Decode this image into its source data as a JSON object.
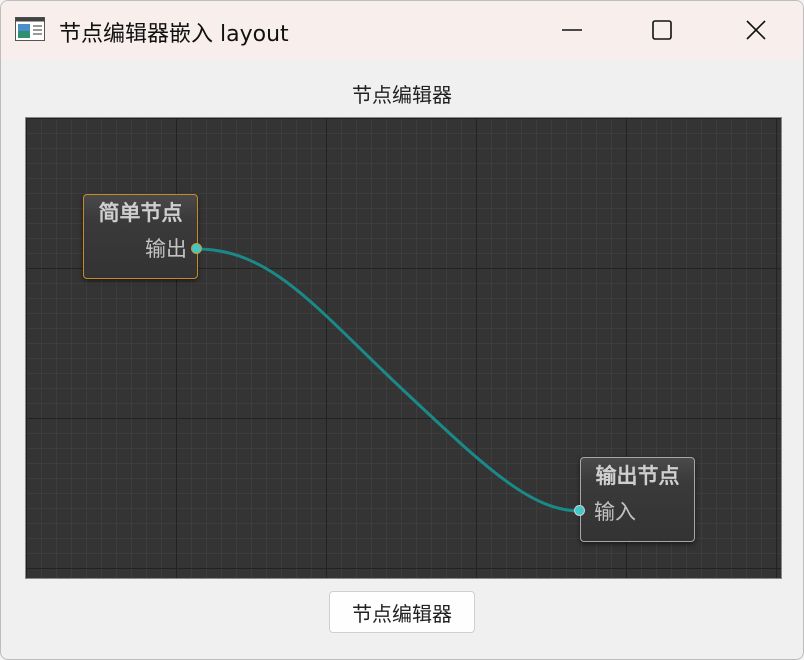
{
  "window": {
    "title": "节点编辑器嵌入 layout",
    "minimize_icon": "minimize-icon",
    "maximize_icon": "maximize-icon",
    "close_icon": "close-icon"
  },
  "editor": {
    "label": "节点编辑器",
    "background_color": "#343434",
    "connection_color": "#1a8a88",
    "nodes": [
      {
        "title": "简单节点",
        "port_label": "输出",
        "port_type": "output",
        "border_color": "#c8882a"
      },
      {
        "title": "输出节点",
        "port_label": "输入",
        "port_type": "input",
        "border_color": "#a6a6a6"
      }
    ]
  },
  "footer": {
    "button_label": "节点编辑器"
  }
}
